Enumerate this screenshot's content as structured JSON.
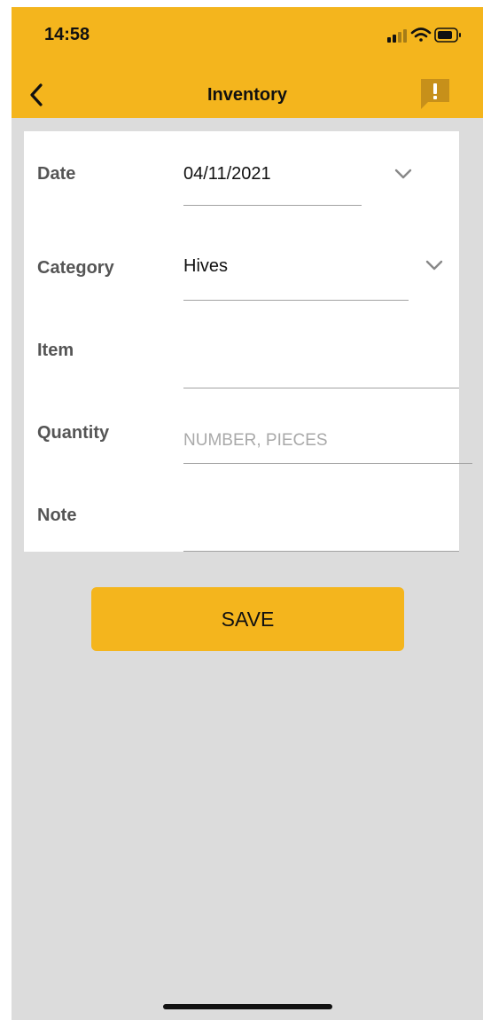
{
  "status_bar": {
    "time": "14:58"
  },
  "nav": {
    "title": "Inventory"
  },
  "form": {
    "date": {
      "label": "Date",
      "value": "04/11/2021"
    },
    "category": {
      "label": "Category",
      "value": "Hives"
    },
    "item": {
      "label": "Item",
      "value": ""
    },
    "quantity": {
      "label": "Quantity",
      "placeholder": "NUMBER, PIECES"
    },
    "note": {
      "label": "Note",
      "value": ""
    }
  },
  "actions": {
    "save_label": "SAVE"
  },
  "colors": {
    "accent": "#f4b51d",
    "background": "#dcdcdc",
    "card": "#ffffff"
  },
  "icons": [
    "back-chevron-icon",
    "report-icon",
    "chevron-down-icon",
    "signal-icon",
    "wifi-icon",
    "battery-icon"
  ]
}
